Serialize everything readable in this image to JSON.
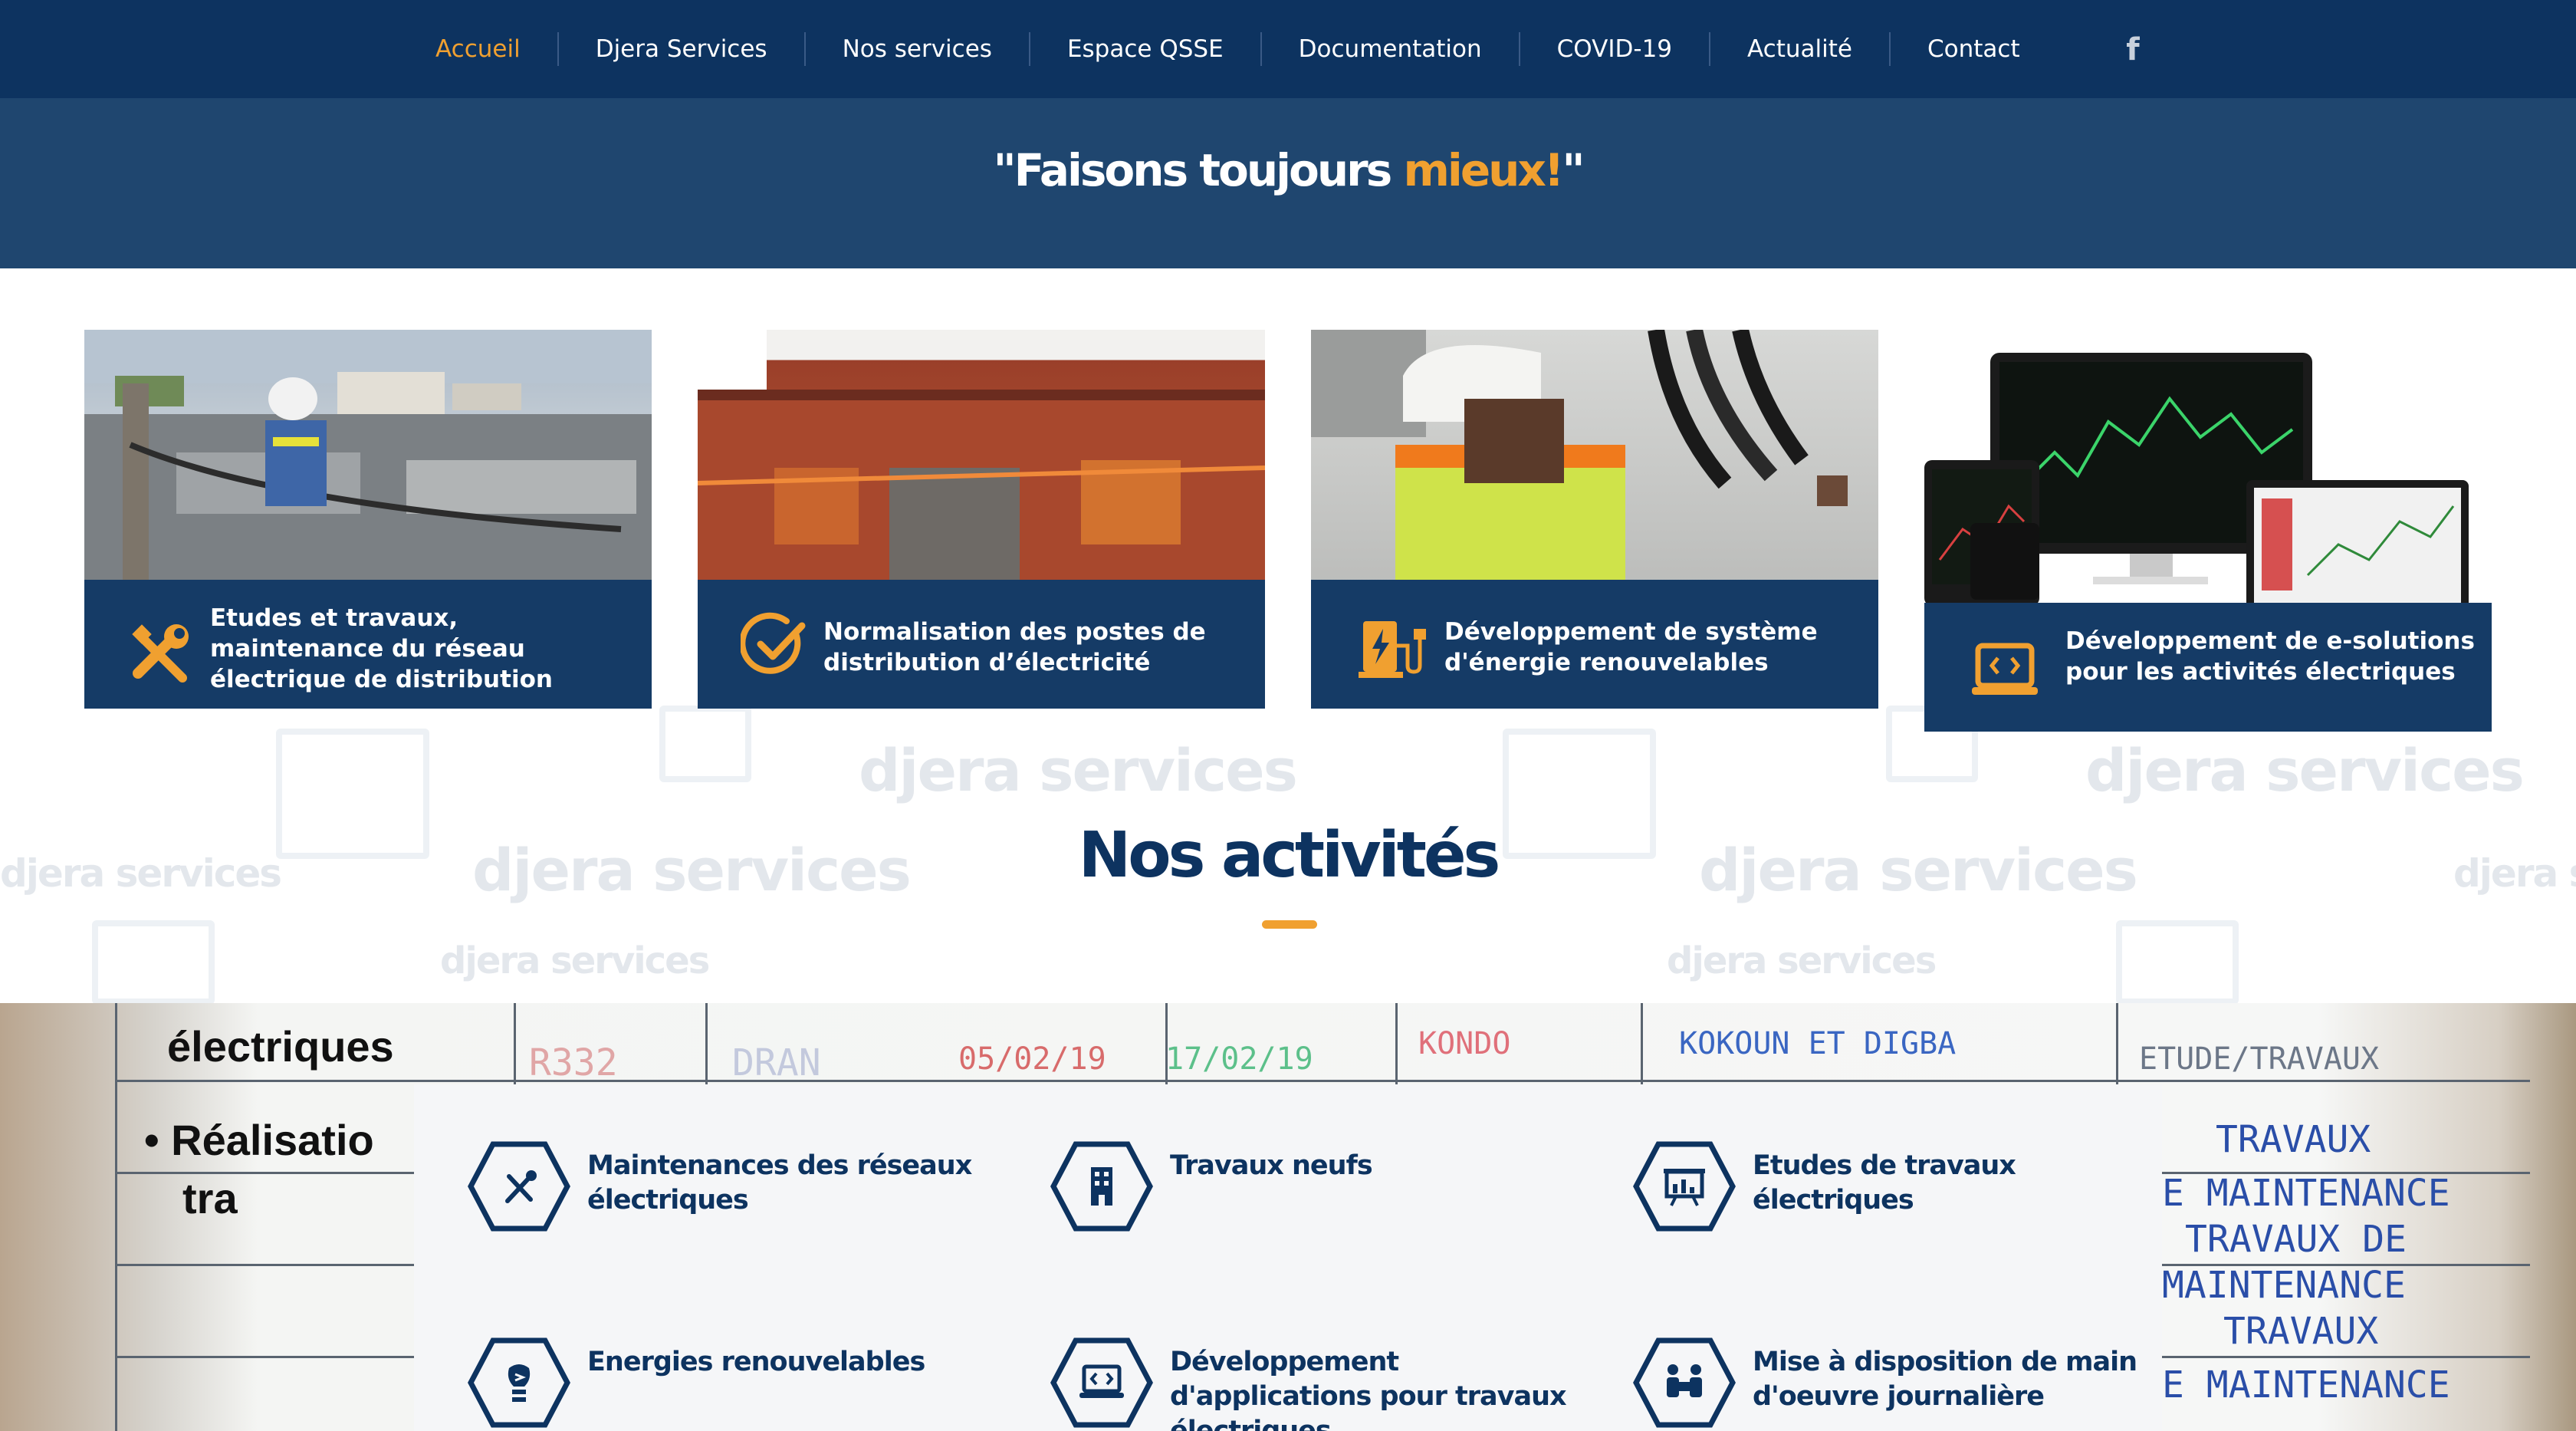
{
  "nav": {
    "items": [
      {
        "label": "Accueil",
        "active": true
      },
      {
        "label": "Djera Services",
        "active": false
      },
      {
        "label": "Nos services",
        "active": false
      },
      {
        "label": "Espace QSSE",
        "active": false
      },
      {
        "label": "Documentation",
        "active": false
      },
      {
        "label": "COVID-19",
        "active": false
      },
      {
        "label": "Actualité",
        "active": false
      },
      {
        "label": "Contact",
        "active": false
      }
    ],
    "social_icon": "facebook-icon",
    "social_glyph": "f"
  },
  "slogan": {
    "part1": "\"Faisons toujours ",
    "highlight": "mieux!",
    "part2": "\""
  },
  "watermark": {
    "brand": "djera services"
  },
  "services": [
    {
      "label": "Etudes et travaux, maintenance du réseau électrique de distribution",
      "icon": "tools-icon"
    },
    {
      "label": "Normalisation des postes de distribution d’électricité",
      "icon": "check-circle-icon"
    },
    {
      "label": "Développement de système d'énergie renouvelables",
      "icon": "charging-station-icon"
    },
    {
      "label": "Développement de e-solutions pour les activités électriques",
      "icon": "laptop-code-icon"
    }
  ],
  "activities_title": "Nos activités",
  "activities": [
    {
      "label": "Maintenances des réseaux électriques",
      "icon": "tools-icon"
    },
    {
      "label": "Travaux neufs",
      "icon": "building-icon"
    },
    {
      "label": "Etudes de travaux électriques",
      "icon": "presentation-icon"
    },
    {
      "label": "Energies renouvelables",
      "icon": "eco-bulb-icon"
    },
    {
      "label": "Développement d'applications pour travaux électriques",
      "icon": "laptop-code-icon"
    },
    {
      "label": "Mise à disposition de main d'oeuvre journalière",
      "icon": "workers-icon"
    }
  ],
  "background_photo": {
    "slide_line1": "électriques",
    "slide_line2": "• Réalisatio",
    "slide_line3": "tra",
    "handwriting": [
      "R332",
      "DRAN",
      "05/02/19",
      "17/02/19",
      "KONDO",
      "KOKOUN ET DIGBA",
      "ETUDE/TRAVAUX",
      "TRAVAUX",
      "E MAINTENANCE",
      "TRAVAUX DE",
      "MAINTENANCE",
      "TRAVAUX",
      "E MAINTENANCE"
    ]
  },
  "colors": {
    "navy": "#0d3360",
    "band_blue": "#1f466f",
    "card_band": "#153b66",
    "accent_orange": "#f0a030"
  }
}
